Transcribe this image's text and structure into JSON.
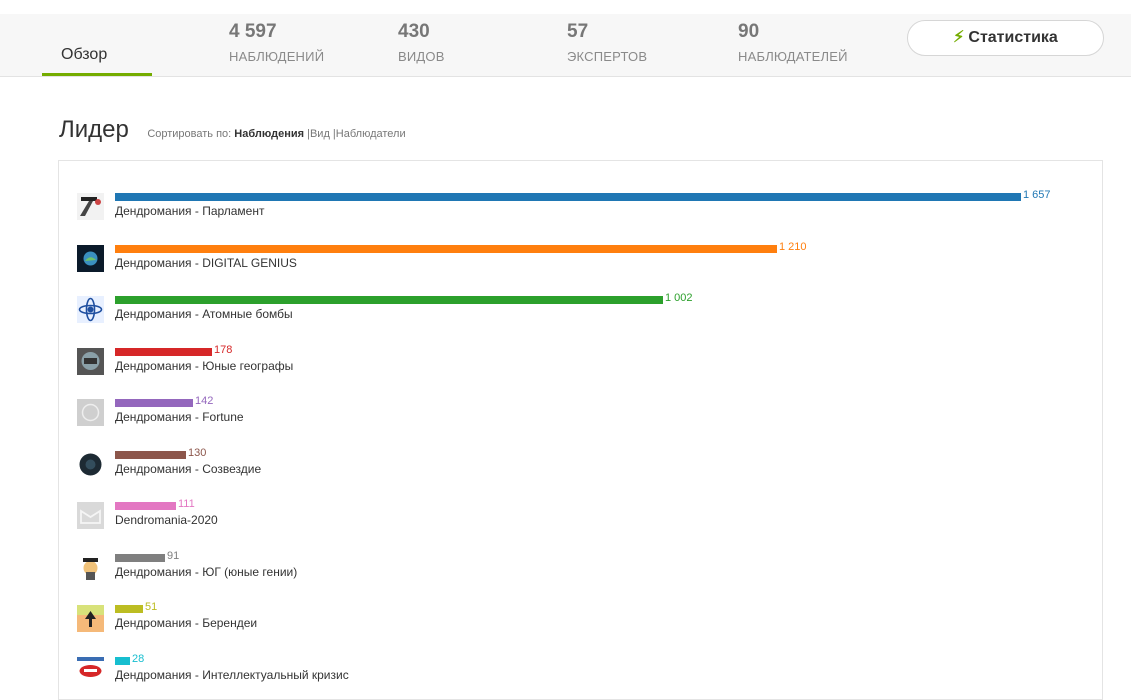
{
  "nav": {
    "overview": "Обзор",
    "stats": [
      {
        "value": "4 597",
        "label": "НАБЛЮДЕНИЙ"
      },
      {
        "value": "430",
        "label": "ВИДОВ"
      },
      {
        "value": "57",
        "label": "ЭКСПЕРТОВ"
      },
      {
        "value": "90",
        "label": "НАБЛЮДАТЕЛЕЙ"
      }
    ],
    "stats_button": "Статистика",
    "accent_color": "#74ac00"
  },
  "leaderboard": {
    "title": "Лидер",
    "sort_prefix": "Сортировать по:",
    "sort_active": "Наблюдения",
    "sort_options": "|Вид |Наблюдатели"
  },
  "chart_data": {
    "type": "bar",
    "orientation": "horizontal",
    "title": "Лидер",
    "categories": [
      "Дендромания - Парламент",
      "Дендромания - DIGITAL GENIUS",
      "Дендромания - Атомные бомбы",
      "Дендромания - Юные географы",
      "Дендромания - Fortune",
      "Дендромания - Созвездие",
      "Dendromania-2020",
      "Дендромания - ЮГ (юные гении)",
      "Дендромания - Берендеи",
      "Дендромания - Интеллектуальный кризис"
    ],
    "values": [
      1657,
      1210,
      1002,
      178,
      142,
      130,
      111,
      91,
      51,
      28
    ],
    "value_labels": [
      "1 657",
      "1 210",
      "1 002",
      "178",
      "142",
      "130",
      "111",
      "91",
      "51",
      "28"
    ],
    "colors": [
      "#1f77b4",
      "#ff7f0e",
      "#2ca02c",
      "#d62728",
      "#9467bd",
      "#8c564b",
      "#e377c2",
      "#7f7f7f",
      "#bcbd22",
      "#17becf"
    ],
    "avatar_icons": [
      "parliament-avatar-icon",
      "digital-genius-avatar-icon",
      "atom-avatar-icon",
      "young-geographers-avatar-icon",
      "fortune-avatar-icon",
      "constellation-avatar-icon",
      "dendromania-2020-avatar-icon",
      "young-geniuses-avatar-icon",
      "berendei-avatar-icon",
      "intellectual-crisis-avatar-icon"
    ],
    "grid": false,
    "legend": "none"
  }
}
